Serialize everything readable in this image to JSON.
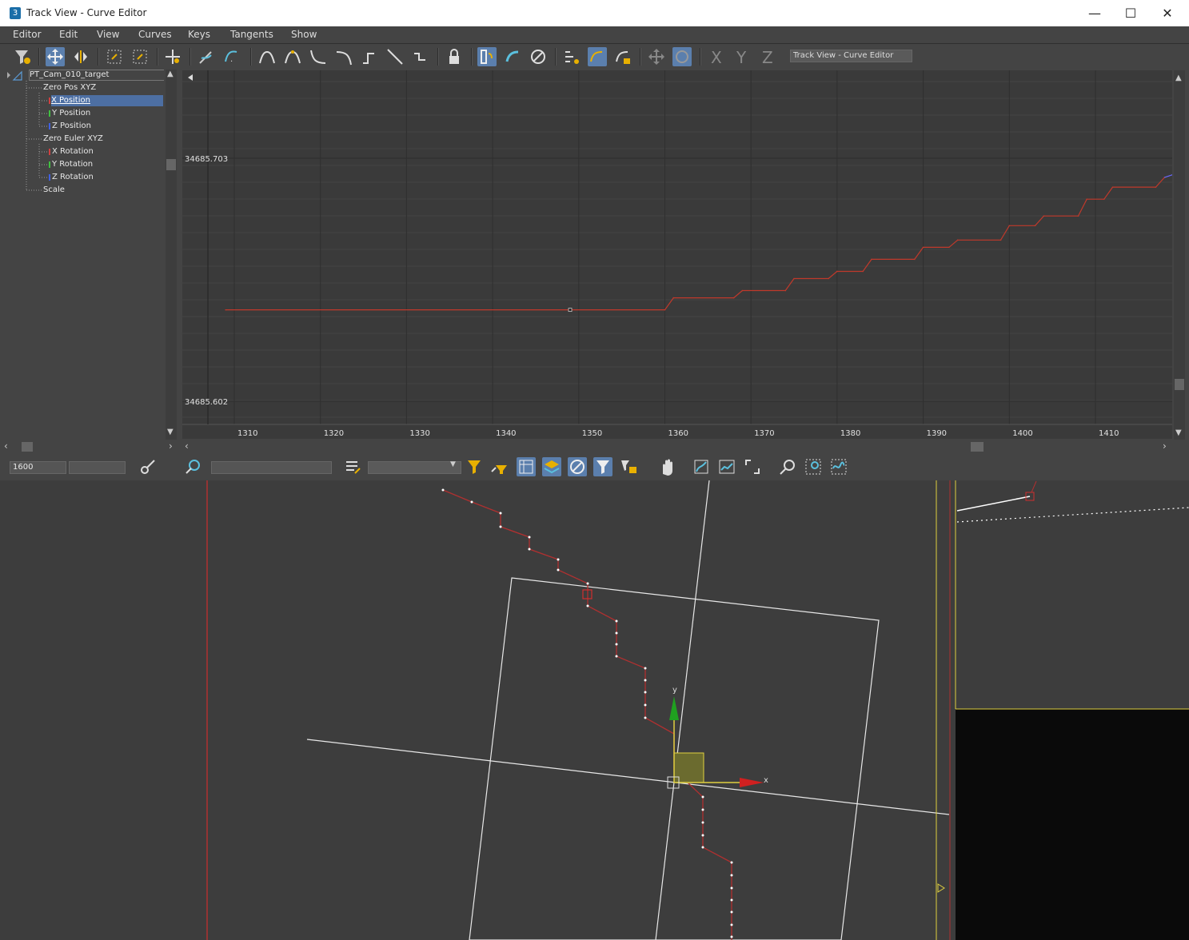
{
  "window": {
    "title": "Track View - Curve Editor",
    "app_icon": "3",
    "minimize": "—",
    "maximize": "☐",
    "close": "✕"
  },
  "menu": [
    "Editor",
    "Edit",
    "View",
    "Curves",
    "Keys",
    "Tangents",
    "Show"
  ],
  "toolbar": {
    "track_view_name": "Track View - Curve Editor"
  },
  "tree": {
    "root": "PT_Cam_010_target",
    "items": [
      {
        "label": "Zero Pos XYZ",
        "indent": 1
      },
      {
        "label": "X Position",
        "indent": 2,
        "selected": true,
        "color": "#d04040"
      },
      {
        "label": "Y Position",
        "indent": 2,
        "color": "#40c040"
      },
      {
        "label": "Z Position",
        "indent": 2,
        "color": "#4060e0"
      },
      {
        "label": "Zero Euler XYZ",
        "indent": 1
      },
      {
        "label": "X Rotation",
        "indent": 2,
        "color": "#d04040"
      },
      {
        "label": "Y Rotation",
        "indent": 2,
        "color": "#40c040"
      },
      {
        "label": "Z Rotation",
        "indent": 2,
        "color": "#4060e0"
      },
      {
        "label": "Scale",
        "indent": 1
      }
    ]
  },
  "chart_data": {
    "type": "line",
    "title": "",
    "xlabel": "",
    "ylabel": "",
    "x_ticks": [
      1310,
      1320,
      1330,
      1340,
      1350,
      1360,
      1370,
      1380,
      1390,
      1400,
      1410
    ],
    "y_labels": [
      "34685.703",
      "34685.602"
    ],
    "series": [
      {
        "color": "#c0392b",
        "points": [
          [
            1309,
            34685.64
          ],
          [
            1349,
            34685.64
          ],
          [
            1360,
            34685.64
          ],
          [
            1361,
            34685.645
          ],
          [
            1368,
            34685.645
          ],
          [
            1369,
            34685.648
          ],
          [
            1374,
            34685.648
          ],
          [
            1375,
            34685.653
          ],
          [
            1379,
            34685.653
          ],
          [
            1380,
            34685.656
          ],
          [
            1383,
            34685.656
          ],
          [
            1384,
            34685.661
          ],
          [
            1389,
            34685.661
          ],
          [
            1390,
            34685.666
          ],
          [
            1393,
            34685.666
          ],
          [
            1394,
            34685.669
          ],
          [
            1399,
            34685.669
          ],
          [
            1400,
            34685.675
          ],
          [
            1403,
            34685.675
          ],
          [
            1404,
            34685.679
          ],
          [
            1408,
            34685.679
          ],
          [
            1409,
            34685.686
          ],
          [
            1411,
            34685.686
          ],
          [
            1412,
            34685.691
          ],
          [
            1417,
            34685.691
          ],
          [
            1418,
            34685.695
          ]
        ]
      }
    ],
    "key_x": 1349
  },
  "bottom_toolbar": {
    "frame_field": "1600",
    "second_field": "",
    "filter_field": "",
    "dropdown_value": ""
  },
  "viewport": {
    "axis_x_label": "x",
    "axis_y_label": "y"
  }
}
